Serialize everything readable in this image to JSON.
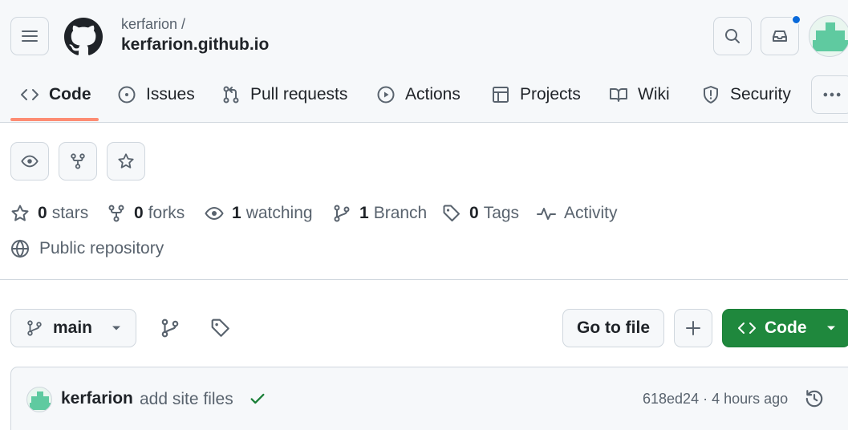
{
  "header": {
    "owner": "kerfarion /",
    "repo": "kerfarion.github.io"
  },
  "tabs": [
    {
      "label": "Code",
      "icon": "code-icon",
      "active": true
    },
    {
      "label": "Issues",
      "icon": "issue-opened-icon"
    },
    {
      "label": "Pull requests",
      "icon": "git-pull-request-icon"
    },
    {
      "label": "Actions",
      "icon": "play-icon"
    },
    {
      "label": "Projects",
      "icon": "table-icon"
    },
    {
      "label": "Wiki",
      "icon": "book-icon"
    },
    {
      "label": "Security",
      "icon": "shield-icon"
    }
  ],
  "stats": {
    "stars": {
      "num": "0",
      "label": "stars"
    },
    "forks": {
      "num": "0",
      "label": "forks"
    },
    "watching": {
      "num": "1",
      "label": "watching"
    },
    "branch": {
      "num": "1",
      "label": "Branch"
    },
    "tags": {
      "num": "0",
      "label": "Tags"
    },
    "activity": {
      "label": "Activity"
    },
    "visibility": "Public repository"
  },
  "branch_bar": {
    "branch": "main",
    "goto_file": "Go to file",
    "code_button": "Code"
  },
  "commit": {
    "author": "kerfarion",
    "message": "add site files",
    "meta": "618ed24 · 4 hours ago"
  },
  "colors": {
    "accent_underline": "#fd8c73",
    "code_button": "#1f883d",
    "notification_dot": "#0969da",
    "check": "#1a7f37",
    "avatar": "#5fcaa0"
  }
}
